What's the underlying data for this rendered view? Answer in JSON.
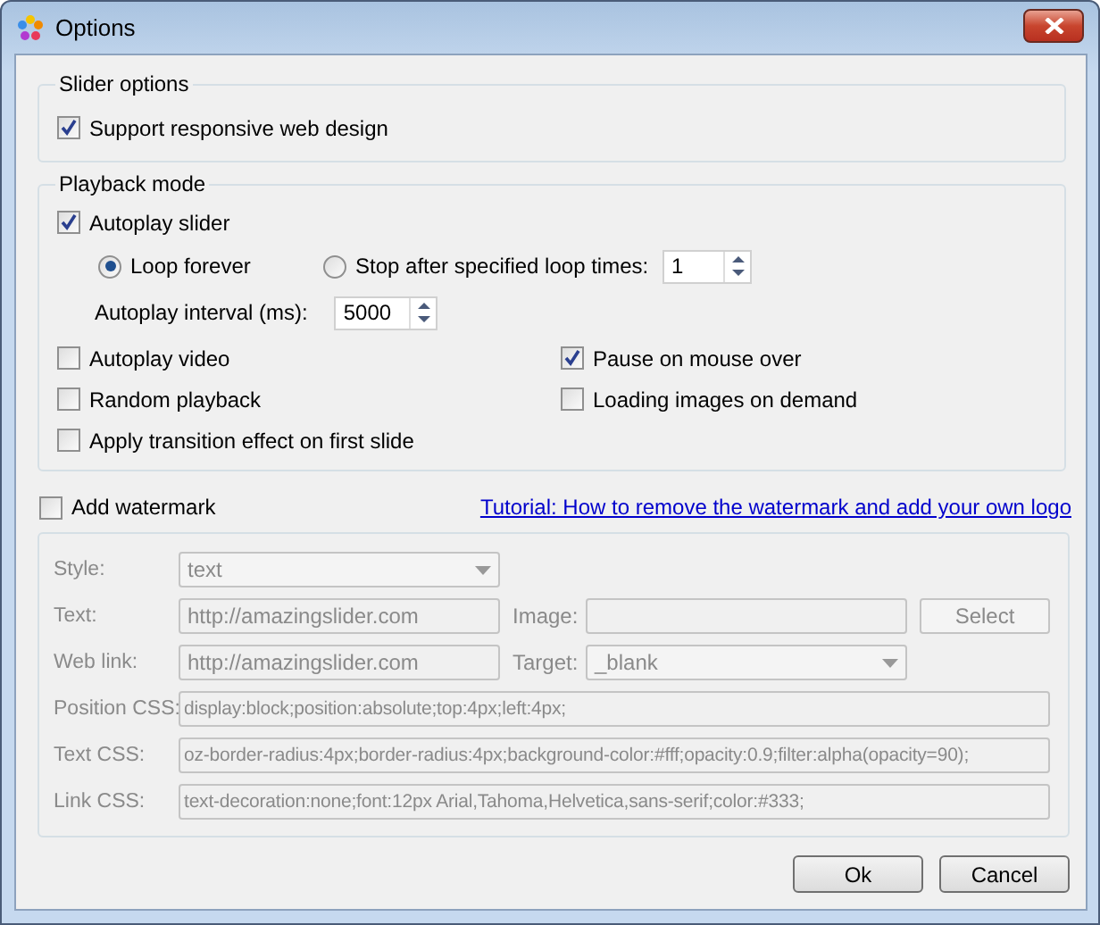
{
  "window": {
    "title": "Options"
  },
  "slider_options": {
    "title": "Slider options",
    "items": [
      {
        "label": "Support responsive web design",
        "checked": true
      }
    ]
  },
  "playback_mode": {
    "title": "Playback mode",
    "autoplay": {
      "label": "Autoplay slider",
      "checked": true
    },
    "loop_options": [
      {
        "label": "Loop forever",
        "selected": true
      },
      {
        "label": "Stop after specified loop times:",
        "selected": false
      }
    ],
    "loop_times": "1",
    "interval": {
      "label": "Autoplay interval (ms):",
      "value": "5000"
    },
    "options": [
      {
        "label": "Autoplay video",
        "checked": false
      },
      {
        "label": "Pause on mouse over",
        "checked": true
      },
      {
        "label": "Random playback",
        "checked": false
      },
      {
        "label": "Loading images on demand",
        "checked": false
      },
      {
        "label": "Apply transition effect on first slide",
        "checked": false
      }
    ]
  },
  "watermark": {
    "label": "Add watermark",
    "checked": false,
    "tutorial_link": "Tutorial: How to remove the watermark and add your own logo",
    "style": {
      "label": "Style:",
      "value": "text"
    },
    "text": {
      "label": "Text:",
      "value": "http://amazingslider.com"
    },
    "image": {
      "label": "Image:"
    },
    "select_button": "Select",
    "web_link": {
      "label": "Web link:",
      "value": "http://amazingslider.com"
    },
    "target": {
      "label": "Target:",
      "value": "_blank"
    },
    "css_fields": [
      {
        "label": "Position CSS:",
        "value": "display:block;position:absolute;top:4px;left:4px;"
      },
      {
        "label": "Text CSS:",
        "value": "oz-border-radius:4px;border-radius:4px;background-color:#fff;opacity:0.9;filter:alpha(opacity=90);"
      },
      {
        "label": "Link CSS:",
        "value": "text-decoration:none;font:12px Arial,Tahoma,Helvetica,sans-serif;color:#333;"
      }
    ]
  },
  "buttons": [
    "Ok",
    "Cancel"
  ]
}
